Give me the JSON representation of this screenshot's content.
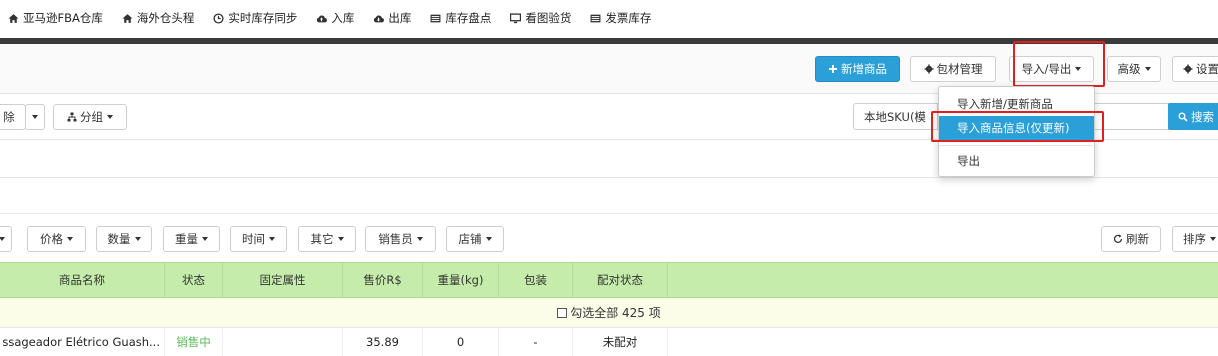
{
  "topnav": {
    "items": [
      {
        "label": "亚马逊FBA仓库",
        "icon": "home-icon"
      },
      {
        "label": "海外仓头程",
        "icon": "home-icon"
      },
      {
        "label": "实时库存同步",
        "icon": "clock-icon"
      },
      {
        "label": "入库",
        "icon": "cloud-upload-icon"
      },
      {
        "label": "出库",
        "icon": "cloud-download-icon"
      },
      {
        "label": "库存盘点",
        "icon": "list-icon"
      },
      {
        "label": "看图验货",
        "icon": "monitor-icon"
      },
      {
        "label": "发票库存",
        "icon": "list-icon"
      }
    ]
  },
  "toolbar": {
    "add_product": "新增商品",
    "packaging": "包材管理",
    "import_export": "导入/导出",
    "advanced": "高级",
    "settings": "设置"
  },
  "row2": {
    "delete_partial": "除",
    "group": "分组",
    "sku_select": "本地SKU(模",
    "search": "搜索"
  },
  "dropdown": {
    "items": [
      "导入新增/更新商品",
      "导入商品信息(仅更新)",
      "导出"
    ],
    "active_index": 1
  },
  "filters": {
    "items": [
      "价格",
      "数量",
      "重量",
      "时间",
      "其它",
      "销售员",
      "店铺"
    ],
    "refresh": "刷新",
    "sort": "排序"
  },
  "table": {
    "headers": [
      "商品名称",
      "状态",
      "固定属性",
      "售价R$",
      "重量(kg)",
      "包装",
      "配对状态"
    ],
    "select_all": "勾选全部 425 项",
    "rows": [
      {
        "name": "ssageador Elétrico Guash...",
        "status": "销售中",
        "attr": "",
        "price": "35.89",
        "weight": "0",
        "pack": "-",
        "match": "未配对"
      }
    ]
  },
  "colors": {
    "accent": "#2a9fd8",
    "header_green": "#c5ecaa",
    "status_green": "#5cb85c",
    "highlight_red": "#e02020"
  }
}
